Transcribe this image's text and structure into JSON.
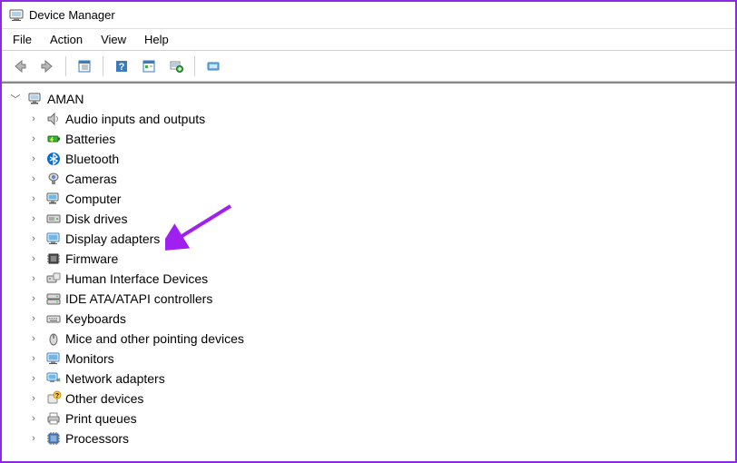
{
  "window": {
    "title": "Device Manager"
  },
  "menubar": {
    "items": [
      "File",
      "Action",
      "View",
      "Help"
    ]
  },
  "toolbar": {
    "buttons": [
      "back",
      "forward",
      "show-hidden",
      "help",
      "properties",
      "scan-hardware",
      "add-legacy"
    ]
  },
  "tree": {
    "root": {
      "label": "AMAN",
      "expanded": true,
      "icon": "computer-root-icon"
    },
    "children": [
      {
        "label": "Audio inputs and outputs",
        "icon": "audio-icon"
      },
      {
        "label": "Batteries",
        "icon": "battery-icon"
      },
      {
        "label": "Bluetooth",
        "icon": "bluetooth-icon"
      },
      {
        "label": "Cameras",
        "icon": "camera-icon"
      },
      {
        "label": "Computer",
        "icon": "computer-icon"
      },
      {
        "label": "Disk drives",
        "icon": "disk-icon"
      },
      {
        "label": "Display adapters",
        "icon": "display-icon"
      },
      {
        "label": "Firmware",
        "icon": "firmware-icon"
      },
      {
        "label": "Human Interface Devices",
        "icon": "hid-icon"
      },
      {
        "label": "IDE ATA/ATAPI controllers",
        "icon": "ide-icon"
      },
      {
        "label": "Keyboards",
        "icon": "keyboard-icon"
      },
      {
        "label": "Mice and other pointing devices",
        "icon": "mouse-icon"
      },
      {
        "label": "Monitors",
        "icon": "monitor-icon"
      },
      {
        "label": "Network adapters",
        "icon": "network-icon"
      },
      {
        "label": "Other devices",
        "icon": "other-icon"
      },
      {
        "label": "Print queues",
        "icon": "printer-icon"
      },
      {
        "label": "Processors",
        "icon": "processor-icon"
      }
    ]
  },
  "annotation": {
    "arrow_color": "#a020f0",
    "target": "Display adapters"
  }
}
